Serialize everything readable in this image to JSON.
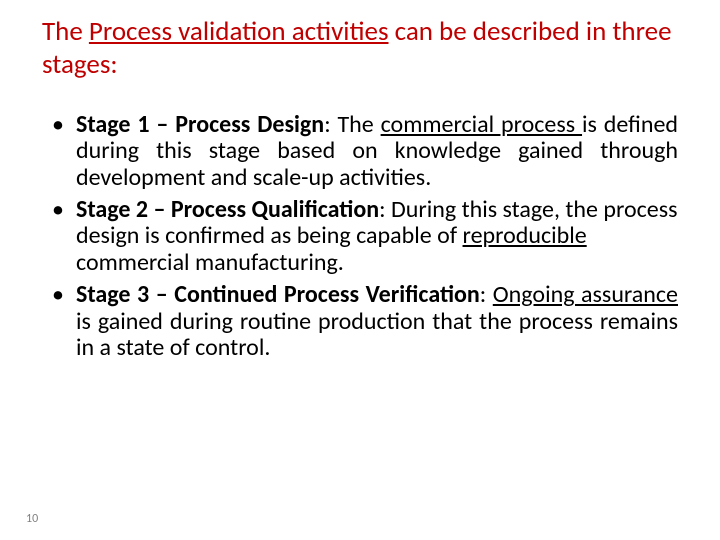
{
  "title": {
    "pre": "The ",
    "underlined": "Process validation activities",
    "post": " can be described in three stages:"
  },
  "bullets": {
    "b1": {
      "head": "Stage 1 – Process Design",
      "t1": ": The ",
      "u1": "commercial process ",
      "t2": "is defined during this stage based on knowledge gained through development and scale-up activities."
    },
    "b2": {
      "head": "Stage 2 – Process Qualification",
      "t1": ": During this stage, the process design is confirmed as being capable of ",
      "u1": "reproducible",
      "t2": " commercial manufacturing."
    },
    "b3": {
      "head": "Stage 3 – Continued Process Verification",
      "t1": ": ",
      "u1": "Ongoing assurance",
      "t2": " is gained during routine production that the process remains in a state of control."
    }
  },
  "pageNumber": "10"
}
